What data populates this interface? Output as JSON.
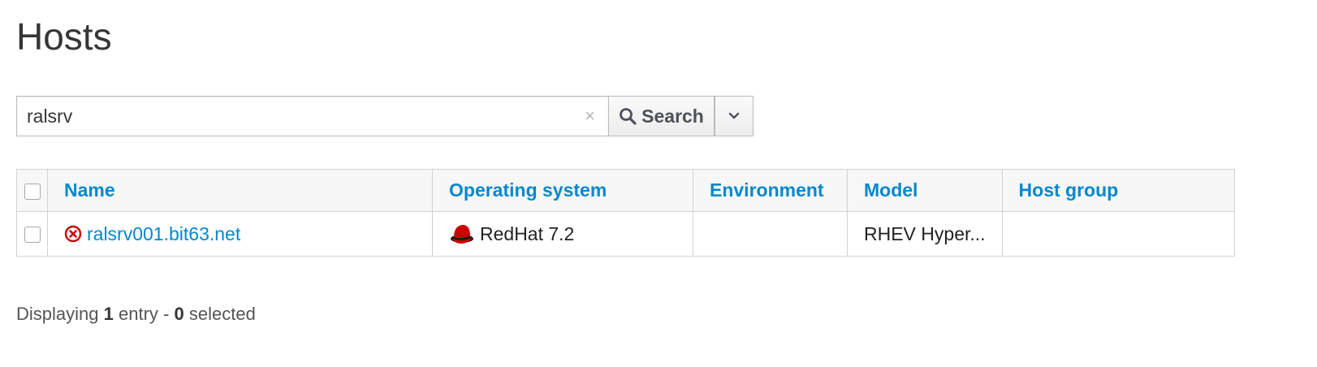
{
  "page": {
    "title": "Hosts"
  },
  "search": {
    "value": "ralsrv",
    "clear_glyph": "×",
    "button_label": "Search"
  },
  "table": {
    "columns": {
      "name": "Name",
      "os": "Operating system",
      "environment": "Environment",
      "model": "Model",
      "host_group": "Host group"
    },
    "rows": [
      {
        "name": "ralsrv001.bit63.net",
        "operating_system": "RedHat 7.2",
        "environment": "",
        "model": "RHEV Hyper...",
        "host_group": ""
      }
    ]
  },
  "footer": {
    "prefix": "Displaying",
    "count": "1",
    "middle": "entry -",
    "selected": "0",
    "suffix": "selected"
  },
  "icons": {
    "status": "error-circle-icon",
    "os": "redhat-icon",
    "search": "search-icon",
    "dropdown": "chevron-down-icon"
  },
  "colors": {
    "link": "#0088ce",
    "error": "#cc0000",
    "redhat": "#cc0000"
  }
}
